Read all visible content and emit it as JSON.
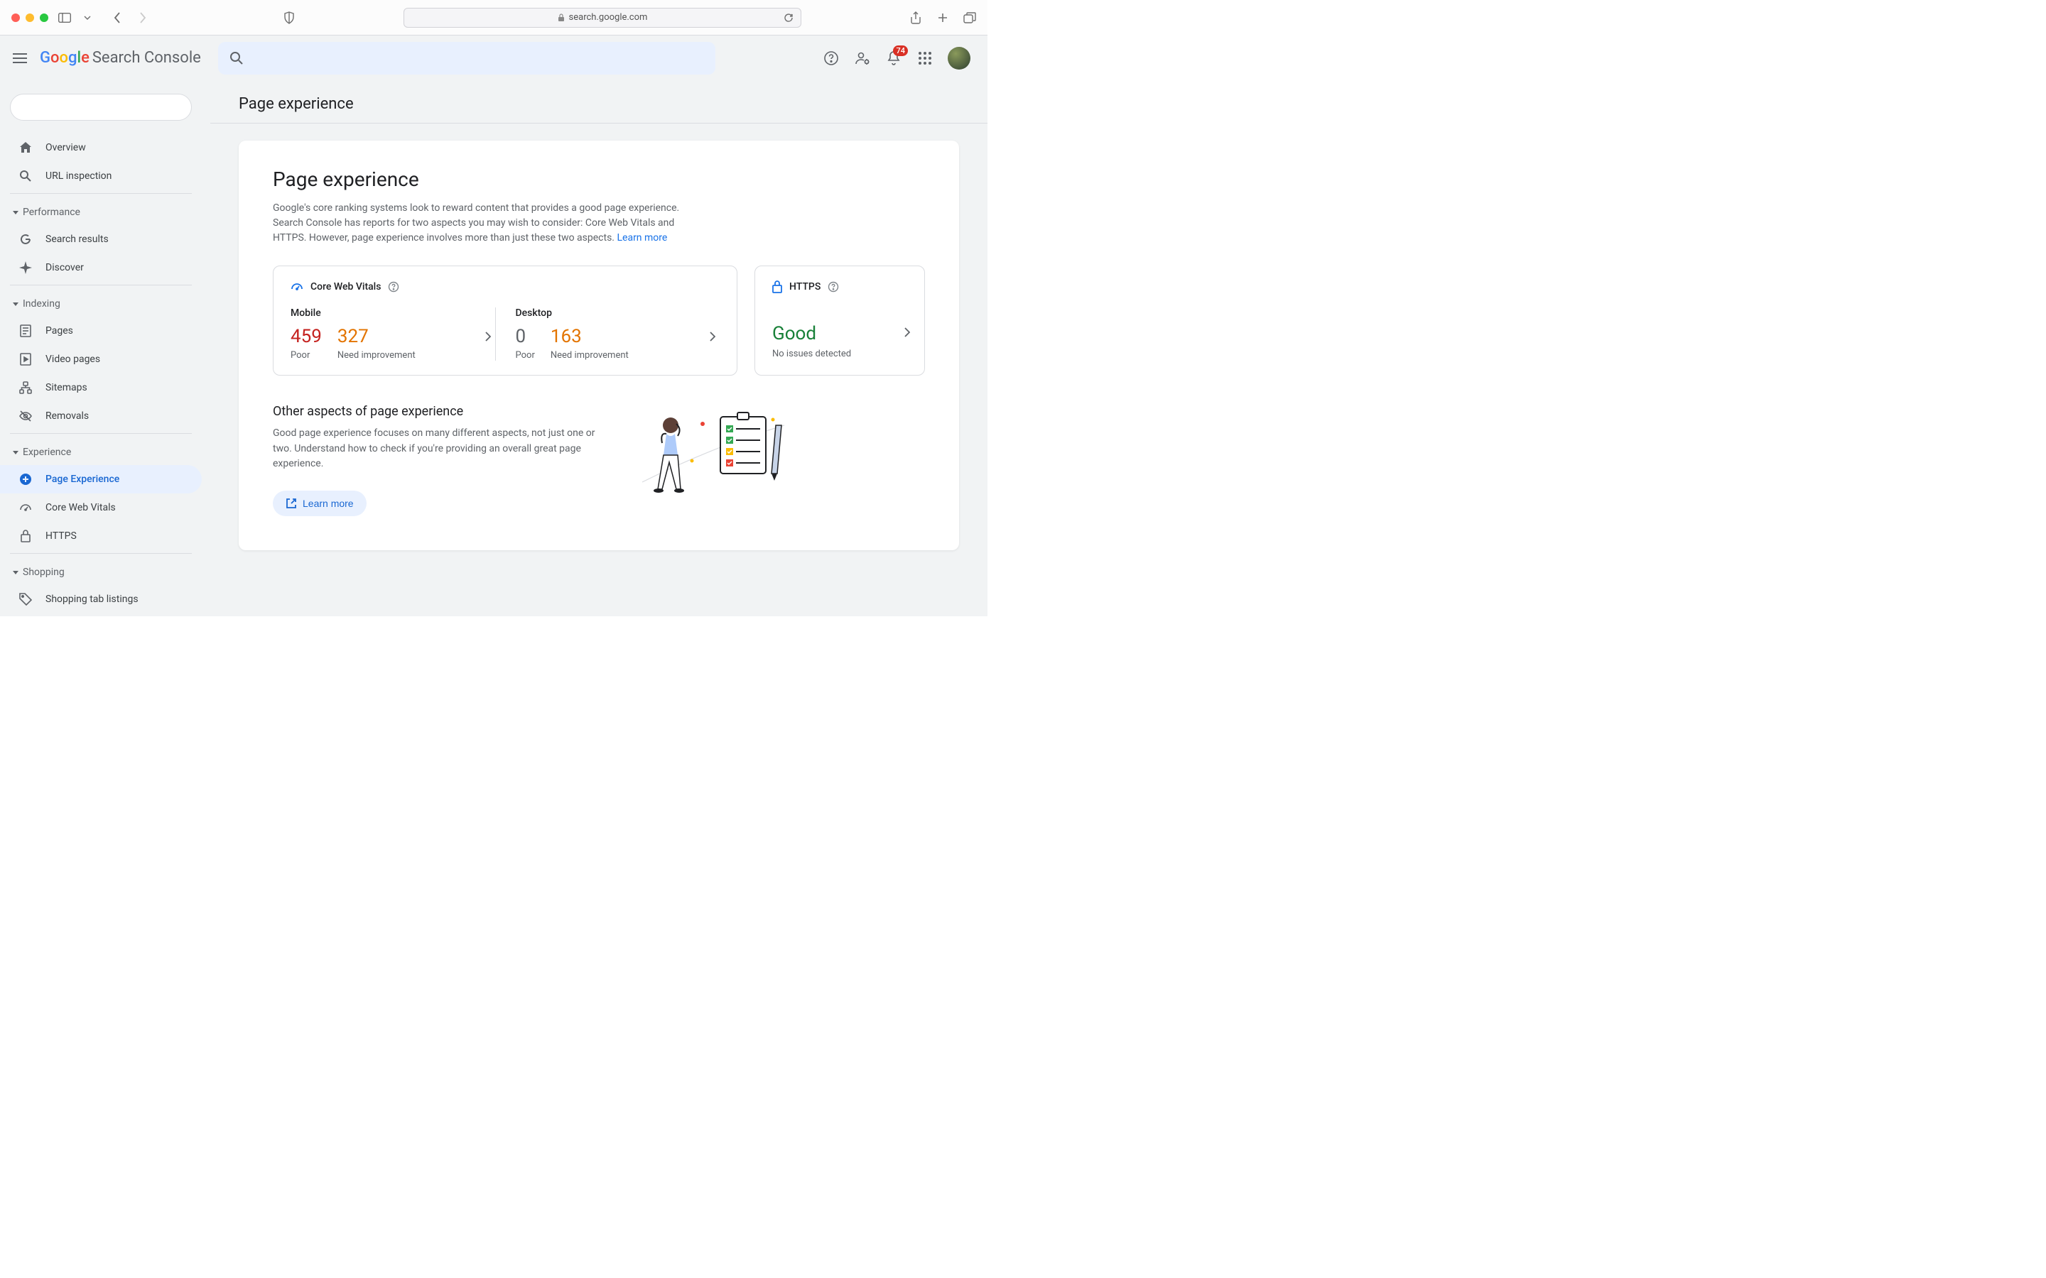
{
  "browser": {
    "url": "search.google.com"
  },
  "header": {
    "logo_text": "Google",
    "logo_suffix": "Search Console",
    "notification_count": "74"
  },
  "sidebar": {
    "items": {
      "overview": "Overview",
      "url_inspection": "URL inspection",
      "search_results": "Search results",
      "discover": "Discover",
      "pages": "Pages",
      "video_pages": "Video pages",
      "sitemaps": "Sitemaps",
      "removals": "Removals",
      "page_experience": "Page Experience",
      "core_web_vitals": "Core Web Vitals",
      "https": "HTTPS",
      "shopping_tab": "Shopping tab listings"
    },
    "sections": {
      "performance": "Performance",
      "indexing": "Indexing",
      "experience": "Experience",
      "shopping": "Shopping"
    }
  },
  "main": {
    "page_title": "Page experience",
    "card_title": "Page experience",
    "card_desc": "Google's core ranking systems look to reward content that provides a good page experience. Search Console has reports for two aspects you may wish to consider: Core Web Vitals and HTTPS. However, page experience involves more than just these two aspects. ",
    "learn_more": "Learn more",
    "cwv": {
      "title": "Core Web Vitals",
      "mobile_label": "Mobile",
      "desktop_label": "Desktop",
      "poor_label": "Poor",
      "needs_label": "Need improvement",
      "mobile_poor": "459",
      "mobile_needs": "327",
      "desktop_poor": "0",
      "desktop_needs": "163"
    },
    "https": {
      "title": "HTTPS",
      "status": "Good",
      "subtitle": "No issues detected"
    },
    "other": {
      "title": "Other aspects of page experience",
      "desc": "Good page experience focuses on many different aspects, not just one or two. Understand how to check if you're providing an overall great page experience.",
      "button": "Learn more"
    }
  }
}
